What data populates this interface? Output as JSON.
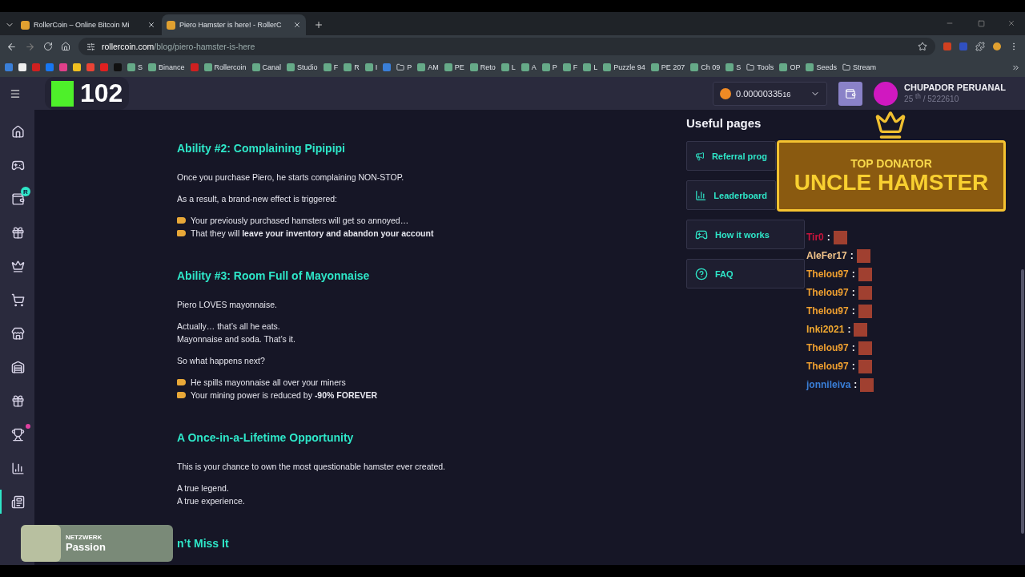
{
  "browser": {
    "tabs": [
      {
        "title": "RollerCoin – Online Bitcoin Mi",
        "selected": false
      },
      {
        "title": "Piero Hamster is here! - RollerC",
        "selected": true
      }
    ],
    "url_host": "rollercoin.com",
    "url_path": "/blog/piero-hamster-is-here",
    "bookmarks": [
      {
        "kind": "icon"
      },
      {
        "kind": "icon"
      },
      {
        "kind": "icon"
      },
      {
        "kind": "icon"
      },
      {
        "kind": "icon"
      },
      {
        "kind": "icon"
      },
      {
        "kind": "icon"
      },
      {
        "kind": "icon"
      },
      {
        "kind": "icon"
      },
      {
        "kind": "link",
        "label": "S"
      },
      {
        "kind": "link",
        "label": "Binance"
      },
      {
        "kind": "icon"
      },
      {
        "kind": "link",
        "label": "Rollercoin"
      },
      {
        "kind": "link",
        "label": "Canal"
      },
      {
        "kind": "link",
        "label": "Studio"
      },
      {
        "kind": "link",
        "label": "F"
      },
      {
        "kind": "link",
        "label": "R"
      },
      {
        "kind": "link",
        "label": "I"
      },
      {
        "kind": "icon"
      },
      {
        "kind": "folder",
        "label": "P"
      },
      {
        "kind": "link",
        "label": "AM"
      },
      {
        "kind": "link",
        "label": "PE"
      },
      {
        "kind": "link",
        "label": "Reto"
      },
      {
        "kind": "link",
        "label": "L"
      },
      {
        "kind": "link",
        "label": "A"
      },
      {
        "kind": "link",
        "label": "P"
      },
      {
        "kind": "link",
        "label": "F"
      },
      {
        "kind": "link",
        "label": "L"
      },
      {
        "kind": "link",
        "label": "Puzzle 94"
      },
      {
        "kind": "link",
        "label": "PE 207"
      },
      {
        "kind": "link",
        "label": "Ch 09"
      },
      {
        "kind": "link",
        "label": "S"
      },
      {
        "kind": "folder",
        "label": "Tools"
      },
      {
        "kind": "link",
        "label": "OP"
      },
      {
        "kind": "link",
        "label": "Seeds"
      },
      {
        "kind": "folder",
        "label": "Stream"
      }
    ]
  },
  "header": {
    "level": "102",
    "balance": "0.00000335",
    "balance_tail": "16",
    "user_name": "CHUPADOR PERUANAL",
    "rank": "25 $^{th}$ / 5222610"
  },
  "sidebar": {
    "items": [
      {
        "selected": false
      },
      {
        "selected": false
      },
      {
        "selected": false,
        "badge": "R"
      },
      {
        "selected": false
      },
      {
        "selected": false
      },
      {
        "selected": false
      },
      {
        "selected": false
      },
      {
        "selected": false
      },
      {
        "selected": false
      },
      {
        "selected": false,
        "notification": true
      },
      {
        "selected": false
      },
      {
        "selected": true
      }
    ]
  },
  "article": {
    "sections": [
      {
        "heading": "Ability #2: Complaining Pipipipi",
        "blocks": [
          {
            "kind": "para",
            "lines": [
              "Once you purchase Piero, he starts complaining NON-STOP."
            ]
          },
          {
            "kind": "para",
            "lines": [
              "As a result, a brand-new effect is triggered:"
            ]
          },
          {
            "kind": "bullets",
            "lines": [
              "Your previously purchased hamsters will get so annoyed…",
              "That they will **leave your inventory and abandon your account**"
            ]
          }
        ]
      },
      {
        "heading": "Ability #3: Room Full of Mayonnaise",
        "blocks": [
          {
            "kind": "para",
            "lines": [
              "Piero LOVES mayonnaise."
            ]
          },
          {
            "kind": "para",
            "lines": [
              "Actually… that’s all he eats.",
              "Mayonnaise and soda. That’s it."
            ]
          },
          {
            "kind": "para",
            "lines": [
              "So what happens next?"
            ]
          },
          {
            "kind": "bullets",
            "lines": [
              "He spills mayonnaise all over your miners",
              "Your mining power is reduced by **-90% FOREVER**"
            ]
          }
        ]
      },
      {
        "heading": "A Once-in-a-Lifetime Opportunity",
        "blocks": [
          {
            "kind": "para",
            "lines": [
              "This is your chance to own the most questionable hamster ever created."
            ]
          },
          {
            "kind": "para",
            "lines": [
              "A true legend.",
              "A true experience."
            ]
          }
        ]
      },
      {
        "heading": "n’t Miss It"
      }
    ]
  },
  "useful_pages": {
    "title": "Useful pages",
    "links": [
      "Referral prog",
      "Leaderboard",
      "How it works",
      "FAQ"
    ]
  },
  "stream_overlay": {
    "donator_label": "TOP DONATOR",
    "donator_name": "UNCLE HAMSTER",
    "chat": [
      {
        "user": "Tir0",
        "color": "#c8143c"
      },
      {
        "user": "AleFer17",
        "color": "#f2c48a"
      },
      {
        "user": "Thelou97",
        "color": "#f0a030"
      },
      {
        "user": "Thelou97",
        "color": "#f0a030"
      },
      {
        "user": "Thelou97",
        "color": "#f0a030"
      },
      {
        "user": "Inki2021",
        "color": "#f0a830"
      },
      {
        "user": "Thelou97",
        "color": "#f0a030"
      },
      {
        "user": "Thelou97",
        "color": "#f0a030"
      },
      {
        "user": "jonnileiva",
        "color": "#3a7fd8"
      }
    ],
    "separator": ":",
    "now_playing": {
      "artist": "NETZWERK",
      "title": "Passion"
    }
  }
}
